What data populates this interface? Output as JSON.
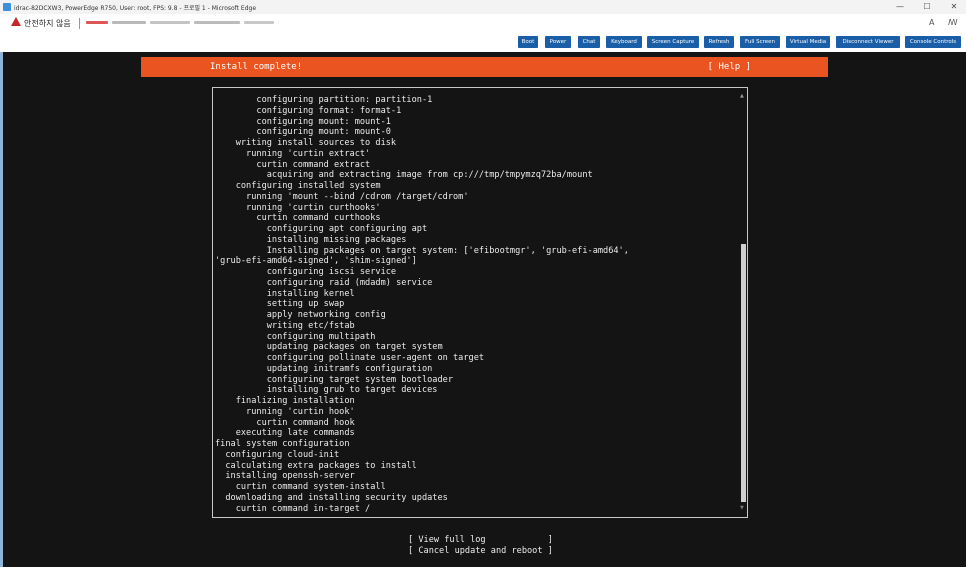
{
  "browser": {
    "title": "idrac-82DCXW3, PowerEdge R750, User: root, FPS: 9.8 - 프로필 1 - Microsoft Edge",
    "minimize_glyph": "—",
    "maximize_glyph": "☐",
    "close_glyph": "✕",
    "security_warning": "안전하지 않음",
    "read_aloud_glyph": "A",
    "immersive_glyph": "ꟿ"
  },
  "console_toolbar": {
    "buttons": [
      "Boot",
      "Power",
      "Chat",
      "Keyboard",
      "Screen Capture",
      "Refresh",
      "Full Screen",
      "Virtual Media",
      "Disconnect Viewer",
      "Console Controls"
    ],
    "color": "#1a5ea7"
  },
  "installer": {
    "header_title": "Install complete!",
    "help": "[ Help ]",
    "accent": "#e95420",
    "log_lines": [
      "        configuring partition: partition-1",
      "        configuring format: format-1",
      "        configuring mount: mount-1",
      "        configuring mount: mount-0",
      "    writing install sources to disk",
      "      running 'curtin extract'",
      "        curtin command extract",
      "          acquiring and extracting image from cp:///tmp/tmpymzq72ba/mount",
      "    configuring installed system",
      "      running 'mount --bind /cdrom /target/cdrom'",
      "      running 'curtin curthooks'",
      "        curtin command curthooks",
      "          configuring apt configuring apt",
      "          installing missing packages",
      "          Installing packages on target system: ['efibootmgr', 'grub-efi-amd64',",
      "'grub-efi-amd64-signed', 'shim-signed']",
      "          configuring iscsi service",
      "          configuring raid (mdadm) service",
      "          installing kernel",
      "          setting up swap",
      "          apply networking config",
      "          writing etc/fstab",
      "          configuring multipath",
      "          updating packages on target system",
      "          configuring pollinate user-agent on target",
      "          updating initramfs configuration",
      "          configuring target system bootloader",
      "          installing grub to target devices",
      "    finalizing installation",
      "      running 'curtin hook'",
      "        curtin command hook",
      "    executing late commands",
      "final system configuration",
      "  configuring cloud-init",
      "  calculating extra packages to install",
      "  installing openssh-server",
      "    curtin command system-install",
      "  downloading and installing security updates",
      "    curtin command in-target /"
    ],
    "view_full_log": "[ View full log            ]",
    "cancel_update_reboot": "[ Cancel update and reboot ]",
    "scroll_up_glyph": "▲",
    "scroll_down_glyph": "▼"
  }
}
